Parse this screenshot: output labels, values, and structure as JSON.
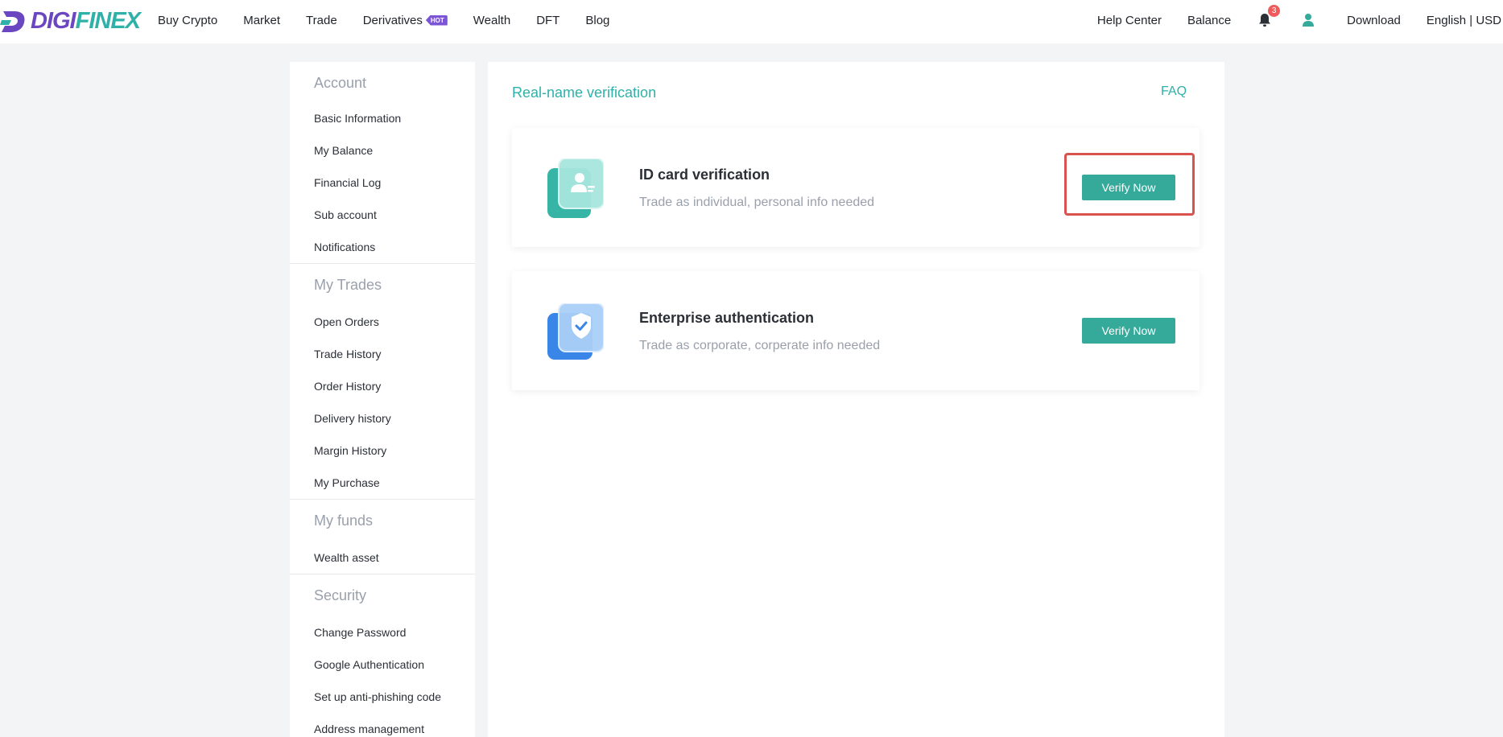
{
  "header": {
    "logo_text_a": "DIGI",
    "logo_text_b": "FINEX",
    "nav": [
      {
        "label": "Buy Crypto"
      },
      {
        "label": "Market"
      },
      {
        "label": "Trade"
      },
      {
        "label": "Derivatives",
        "badge": "HOT"
      },
      {
        "label": "Wealth"
      },
      {
        "label": "DFT"
      },
      {
        "label": "Blog"
      }
    ],
    "help_center": "Help Center",
    "balance": "Balance",
    "notification_count": "3",
    "download": "Download",
    "language_currency": "English | USD"
  },
  "sidebar": {
    "groups": [
      {
        "title": "Account",
        "items": [
          "Basic Information",
          "My Balance",
          "Financial Log",
          "Sub account",
          "Notifications"
        ]
      },
      {
        "title": "My Trades",
        "items": [
          "Open Orders",
          "Trade History",
          "Order History",
          "Delivery history",
          "Margin History",
          "My Purchase"
        ]
      },
      {
        "title": "My funds",
        "items": [
          "Wealth asset"
        ]
      },
      {
        "title": "Security",
        "items": [
          "Change Password",
          "Google Authentication",
          "Set up anti-phishing code",
          "Address management"
        ]
      }
    ]
  },
  "main": {
    "title": "Real-name verification",
    "faq": "FAQ",
    "cards": [
      {
        "title": "ID card verification",
        "subtitle": "Trade as individual, personal info needed",
        "button": "Verify Now",
        "icon": "id-card-icon"
      },
      {
        "title": "Enterprise authentication",
        "subtitle": "Trade as corporate, corperate info needed",
        "button": "Verify Now",
        "icon": "shield-check-icon"
      }
    ]
  },
  "colors": {
    "accent": "#2fb0a8",
    "button": "#35aa9a",
    "highlight": "#d9534f",
    "brand_purple": "#6b46c1"
  }
}
